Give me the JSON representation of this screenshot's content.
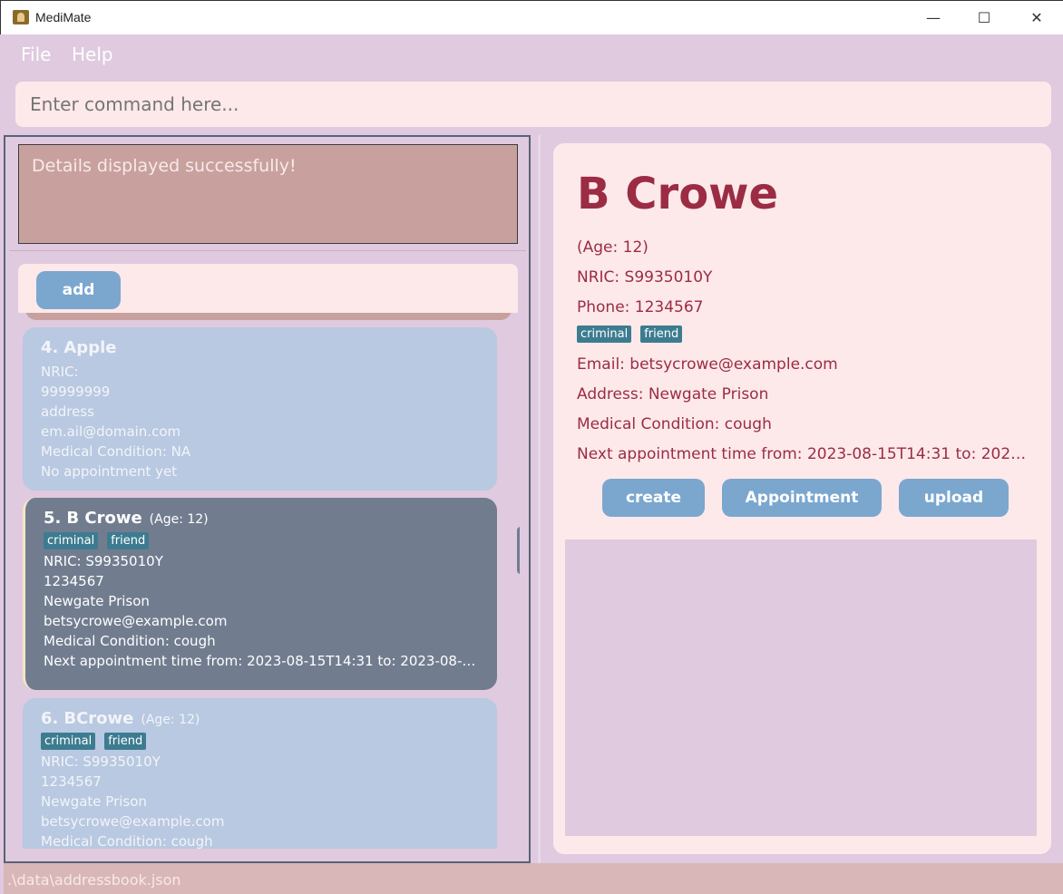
{
  "window": {
    "title": "MediMate",
    "minimize_glyph": "—",
    "maximize_glyph": "☐",
    "close_glyph": "✕"
  },
  "menu": {
    "file": "File",
    "help": "Help"
  },
  "command": {
    "placeholder": "Enter command here..."
  },
  "result": {
    "message": "Details displayed successfully!"
  },
  "list": {
    "add_label": "add",
    "cards": [
      {
        "index": "4.",
        "name": "Apple",
        "age": "",
        "tags": [],
        "lines": [
          "NRIC:",
          "99999999",
          "address",
          "em.ail@domain.com",
          "Medical Condition: NA",
          "No appointment yet"
        ]
      },
      {
        "index": "5.",
        "name": "B Crowe",
        "age": "(Age: 12)",
        "tags": [
          "criminal",
          "friend"
        ],
        "lines": [
          "NRIC: S9935010Y",
          "1234567",
          "Newgate Prison",
          "betsycrowe@example.com",
          "Medical Condition: cough",
          "Next appointment time from: 2023-08-15T14:31 to: 2023-08-15T1..."
        ]
      },
      {
        "index": "6.",
        "name": "BCrowe",
        "age": "(Age: 12)",
        "tags": [
          "criminal",
          "friend"
        ],
        "lines": [
          "NRIC: S9935010Y",
          "1234567",
          "Newgate Prison",
          "betsycrowe@example.com",
          "Medical Condition: cough"
        ]
      }
    ]
  },
  "detail": {
    "name": "B Crowe",
    "age": "(Age: 12)",
    "nric": "NRIC: S9935010Y",
    "phone": "Phone: 1234567",
    "tags": [
      "criminal",
      "friend"
    ],
    "email": "Email: betsycrowe@example.com",
    "address": "Address: Newgate Prison",
    "condition": "Medical Condition: cough",
    "appointment": "Next appointment time from: 2023-08-15T14:31 to: 2023-0...",
    "create_label": "create",
    "appointment_label": "Appointment",
    "upload_label": "upload"
  },
  "status": {
    "path": ".\\data\\addressbook.json"
  },
  "colors": {
    "accent_button": "#7ba7cf",
    "detail_text": "#9b2c44",
    "tag": "#3d7c90",
    "selected_card": "#717d8f"
  }
}
